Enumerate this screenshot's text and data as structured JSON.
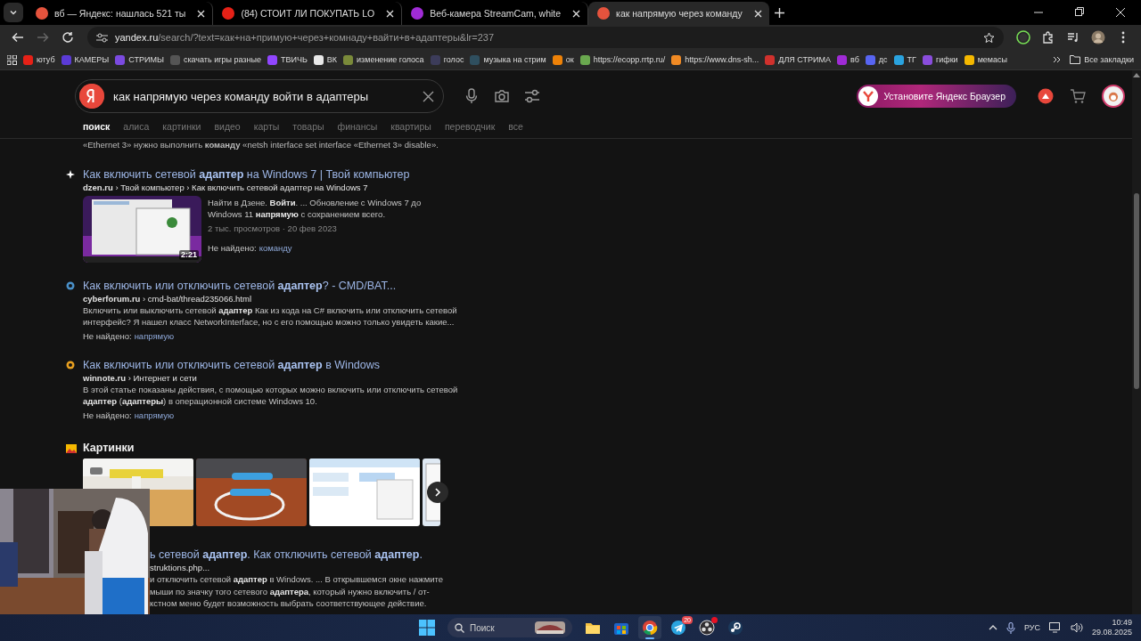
{
  "browser": {
    "tabs": [
      {
        "title": "вб — Яндекс: нашлась 521 ты",
        "color": "#e5533d",
        "selected": false
      },
      {
        "title": "(84) СТОИТ ЛИ ПОКУПАТЬ LO",
        "color": "#e62117",
        "selected": false
      },
      {
        "title": "Веб-камера StreamCam, white",
        "color": "#a02bd6",
        "selected": false
      },
      {
        "title": "как напрямую через команду",
        "color": "#e5533d",
        "selected": true
      }
    ],
    "address": {
      "host": "yandex.ru",
      "path": "/search/?text=как+на+примую+через+комнаду+вайти+в+адаптеры&lr=237"
    },
    "bookmarks": [
      {
        "label": "ютуб",
        "color": "#e62117"
      },
      {
        "label": "КАМЕРЫ",
        "color": "#5b3bd6"
      },
      {
        "label": "СТРИМЫ",
        "color": "#7b4ae0"
      },
      {
        "label": "скачать игры разные",
        "color": "#555555"
      },
      {
        "label": "ТВИЧЬ",
        "color": "#9146ff"
      },
      {
        "label": "ВК",
        "color": "#e8e8e8"
      },
      {
        "label": "изменение голоса",
        "color": "#7a8a3a"
      },
      {
        "label": "голос",
        "color": "#3c3c5a"
      },
      {
        "label": "музыка на стрим",
        "color": "#2f4f5f"
      },
      {
        "label": "ок",
        "color": "#ee8208"
      },
      {
        "label": "https://ecopp.rrtp.ru/",
        "color": "#6aa84f"
      },
      {
        "label": "https://www.dns-sh...",
        "color": "#f08a24"
      },
      {
        "label": "ДЛЯ СТРИМА",
        "color": "#d0312d"
      },
      {
        "label": "вб",
        "color": "#a02bd6"
      },
      {
        "label": "дс",
        "color": "#5865f2"
      },
      {
        "label": "ТГ",
        "color": "#2aa3df"
      },
      {
        "label": "гифки",
        "color": "#8a4ddc"
      },
      {
        "label": "мемасы",
        "color": "#f5b800"
      }
    ],
    "all_bookmarks": "Все закладки"
  },
  "page": {
    "search": {
      "value": "как напрямую через команду войти в адаптеры"
    },
    "install_button": "Установите Яндекс Браузер",
    "nav": [
      {
        "label": "поиск",
        "selected": true
      },
      {
        "label": "алиса",
        "selected": false
      },
      {
        "label": "картинки",
        "selected": false
      },
      {
        "label": "видео",
        "selected": false
      },
      {
        "label": "карты",
        "selected": false
      },
      {
        "label": "товары",
        "selected": false
      },
      {
        "label": "финансы",
        "selected": false
      },
      {
        "label": "квартиры",
        "selected": false
      },
      {
        "label": "переводчик",
        "selected": false
      },
      {
        "label": "все",
        "selected": false
      }
    ],
    "snippet_top": "«Ethernet 3» нужно выполнить **команду** «netsh interface set interface «Ethernet 3» disable».",
    "results": [
      {
        "kind": "video",
        "color": "#ffffff",
        "title": "Как включить сетевой **адаптер** на Windows 7 | Твой компьютер",
        "path": "**dzen.ru** › Твой компьютер › Как включить сетевой адаптер на Windows 7",
        "duration": "2:21",
        "text": "Найти в Дзене. **Войти**. ... Обновление с Windows 7 до Windows 11 **напрямую** с сохранением всего.",
        "meta": "2 тыс. просмотров · 20 фев 2023",
        "missing_label": "Не найдено:",
        "missing_word": "команду"
      },
      {
        "kind": "text",
        "color": "#4a90c8",
        "title": "Как включить или отключить сетевой **адаптер**? - CMD/BAT...",
        "path": "**cyberforum.ru** › cmd-bat/thread235066.html",
        "text": "Включить или выключить сетевой **адаптер** Как из кода на C# включить или отключить сетевой интерфейс? Я нашел класс NetworkInterface, но с его помощью можно только увидеть какие...",
        "missing_label": "Не найдено:",
        "missing_word": "напрямую"
      },
      {
        "kind": "text",
        "color": "#e8a020",
        "title": "Как включить или отключить сетевой **адаптер** в Windows",
        "path": "**winnote.ru** › Интернет и сети",
        "text": "В этой статье показаны действия, с помощью которых можно включить или отключить сетевой **адаптер** (**адаптеры**) в операционной системе Windows 10.",
        "missing_label": "Не найдено:",
        "missing_word": "напрямую"
      }
    ],
    "images_title": "Картинки",
    "partial_result": {
      "title": "ь сетевой **адаптер**. Как отключить сетевой **адаптер**.",
      "path": "struktions.php...",
      "lines": [
        "и отключить сетевой **адаптер** в Windows. ... В открывшемся окне нажмите",
        "мыши по значку того сетевого **адаптера**, который нужно включить / от-",
        "кстном меню будет возможность выбрать соответствующее действие."
      ]
    }
  },
  "taskbar": {
    "search_placeholder": "Поиск",
    "apps": [
      {
        "kind": "explorer",
        "active": false,
        "notified": false
      },
      {
        "kind": "store",
        "active": false,
        "notified": false
      },
      {
        "kind": "chrome",
        "active": true,
        "notified": false
      },
      {
        "kind": "telegram",
        "active": false,
        "notified": false,
        "badge": "20"
      },
      {
        "kind": "obs",
        "active": false,
        "notified": true
      },
      {
        "kind": "steam",
        "active": false,
        "notified": false
      }
    ],
    "language": "РУС",
    "time": "10:49",
    "date": "29.08.2025"
  }
}
